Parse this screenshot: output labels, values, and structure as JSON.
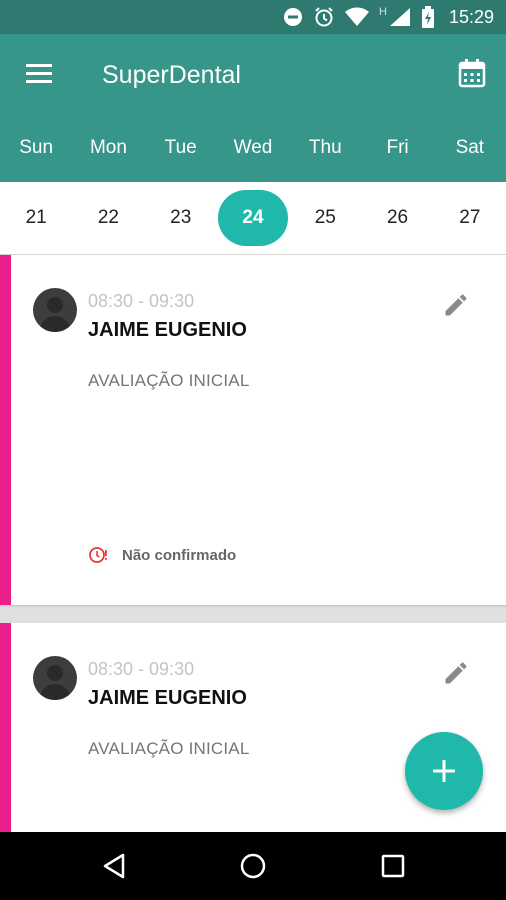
{
  "status_bar": {
    "time": "15:29",
    "network_letter": "H"
  },
  "toolbar": {
    "title": "SuperDental"
  },
  "week": {
    "days": [
      "Sun",
      "Mon",
      "Tue",
      "Wed",
      "Thu",
      "Fri",
      "Sat"
    ],
    "dates": [
      "21",
      "22",
      "23",
      "24",
      "25",
      "26",
      "27"
    ],
    "selected": "24"
  },
  "appointments": [
    {
      "time": "08:30 - 09:30",
      "patient": "JAIME EUGENIO",
      "procedure": "AVALIAÇÃO INICIAL",
      "status": "Não confirmado"
    },
    {
      "time": "08:30 - 09:30",
      "patient": "JAIME EUGENIO",
      "procedure": "AVALIAÇÃO INICIAL"
    }
  ],
  "colors": {
    "primary_dark": "#2e7a70",
    "primary": "#36968a",
    "accent": "#1fb8aa",
    "card_accent": "#ec1f8c",
    "warning": "#e53935"
  }
}
